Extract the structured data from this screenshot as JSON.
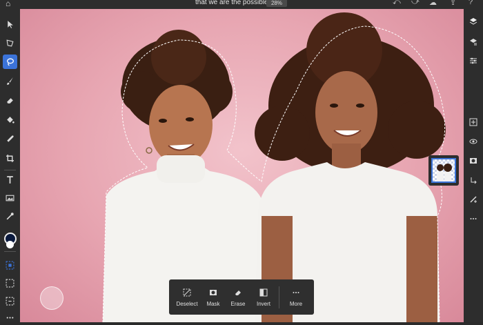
{
  "header": {
    "document_title": "that we are the possible",
    "zoom": "28%"
  },
  "left_tools": [
    "select-tool",
    "transform-tool",
    "lasso-tool",
    "brush-tool",
    "eraser-tool",
    "fill-tool",
    "healing-tool",
    "crop-tool",
    "type-tool",
    "place-image-tool",
    "eyedropper-tool",
    "color-swatch",
    "select-subject-tool",
    "select-tool-2",
    "select-tool-3",
    "more-tools"
  ],
  "right_tools": [
    "layers",
    "layer-properties",
    "adjustments",
    "add-layer",
    "visibility",
    "mask",
    "clip",
    "effects",
    "more"
  ],
  "bottom_bar": {
    "deselect_label": "Deselect",
    "mask_label": "Mask",
    "erase_label": "Erase",
    "invert_label": "Invert",
    "more_label": "More"
  },
  "colors": {
    "accent": "#3b73d9",
    "foreground_color": "#0b1a3e",
    "background_color": "#ffffff",
    "canvas_bg": "#e7a5b1"
  }
}
